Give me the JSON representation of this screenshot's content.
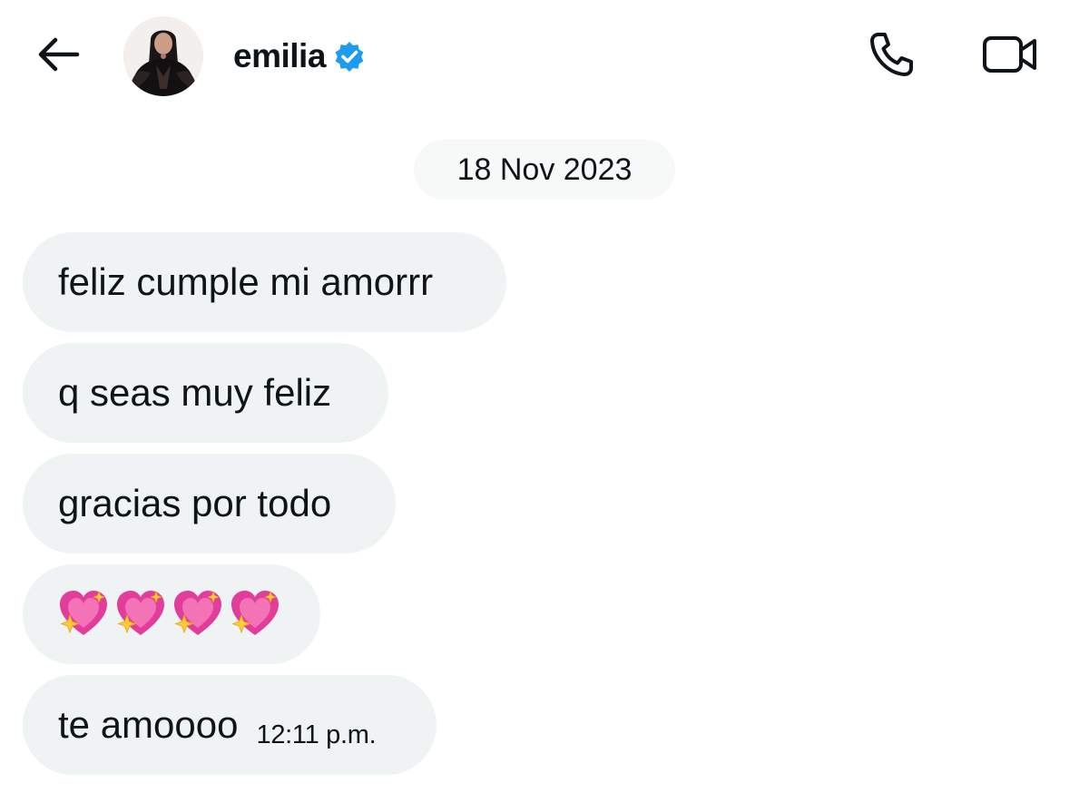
{
  "header": {
    "back_icon": "arrow-left-icon",
    "contact_name": "emilia",
    "verified_icon": "verified-badge-icon",
    "verified_color": "#1d9bf0",
    "call_icon": "phone-icon",
    "video_icon": "video-camera-icon"
  },
  "conversation": {
    "date_separator": "18 Nov 2023",
    "messages": [
      {
        "text": "feliz cumple mi amorrr"
      },
      {
        "text": "q seas muy feliz"
      },
      {
        "text": "gracias por todo"
      },
      {
        "emoji": "sparkling-heart-icon",
        "count": 4
      },
      {
        "text": "te amoooo",
        "time": "12:11 p.m."
      }
    ]
  },
  "colors": {
    "bubble_background": "#eff3f4",
    "date_pill_background": "#f7f9f9",
    "text": "#0f1419",
    "heart_pink": "#e23d9a"
  }
}
